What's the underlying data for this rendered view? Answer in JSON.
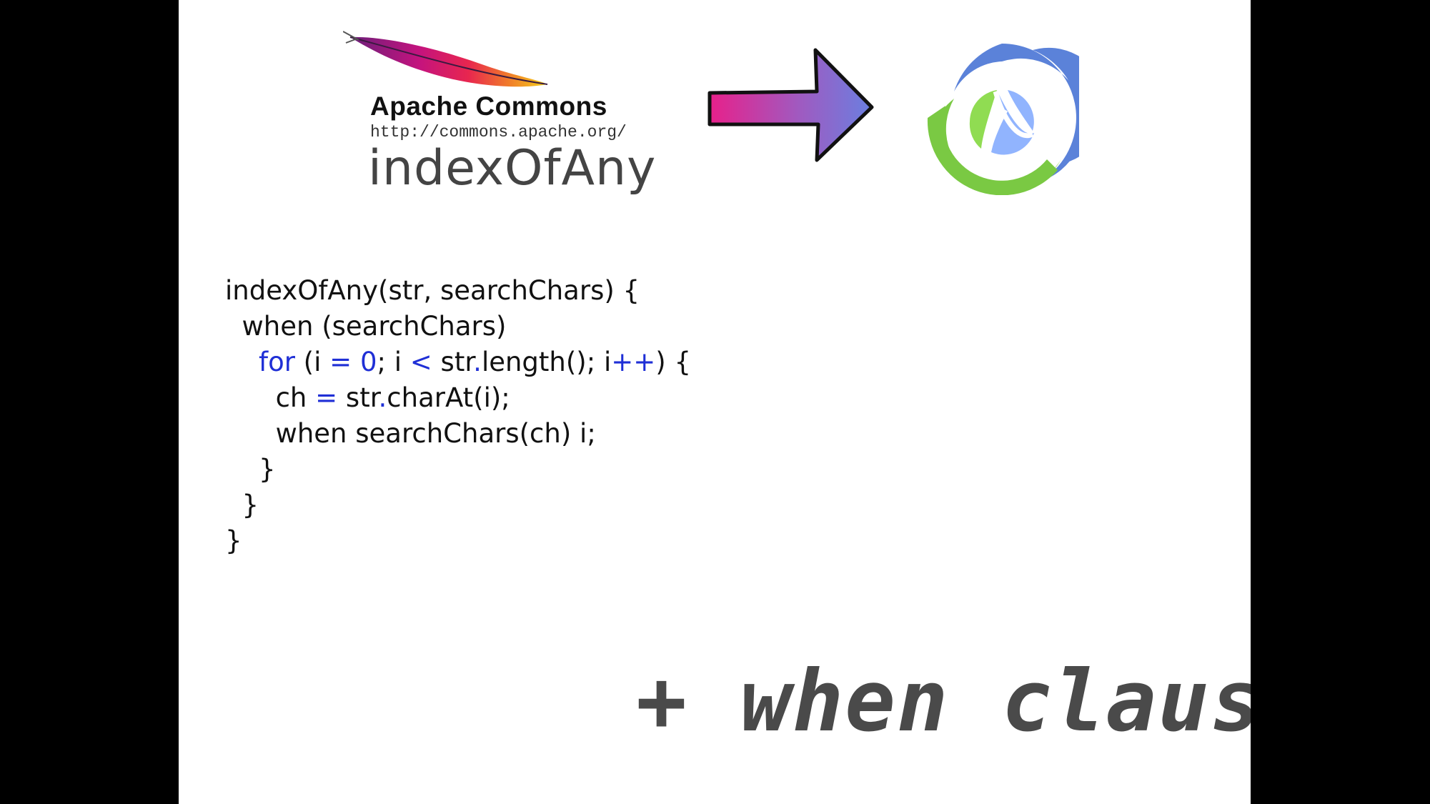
{
  "slide": {
    "apache_title": "Apache Commons",
    "apache_url": "http://commons.apache.org/",
    "function_name": "indexOfAny",
    "tagline": "+ when clause"
  },
  "code": {
    "line1": "indexOfAny(str, searchChars) {",
    "line2": "  when (searchChars)",
    "line3_for": "for",
    "line3_a": " (i ",
    "line3_eq": "=",
    "line3_space": " ",
    "line3_zero": "0",
    "line3_b": "; i ",
    "line3_lt": "<",
    "line3_c": " str",
    "line3_dot": ".",
    "line3_d": "length(); i",
    "line3_pp": "++",
    "line3_e": ") {",
    "line4_a": "ch ",
    "line4_eq": "=",
    "line4_b": " str",
    "line4_dot": ".",
    "line4_c": "charAt(i);",
    "line5": "when searchChars(ch) i;",
    "line6": "}",
    "line7": "}",
    "line8": "}"
  },
  "colors": {
    "keyword": "#1f2fd6",
    "arrow_start": "#e8208a",
    "arrow_end": "#6a7fe0",
    "clojure_blue": "#5b82d9",
    "clojure_green": "#7ac943"
  },
  "icons": {
    "feather": "apache-feather-icon",
    "arrow": "right-arrow-icon",
    "logo": "clojure-logo-icon"
  }
}
